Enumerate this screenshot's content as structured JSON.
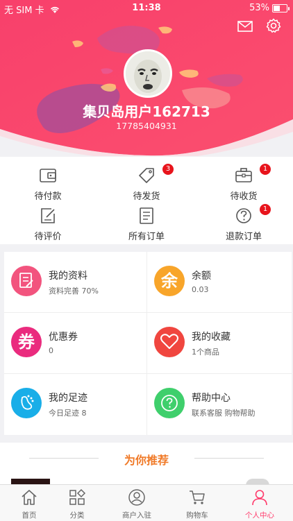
{
  "status_bar": {
    "carrier": "无 SIM 卡",
    "time": "11:38",
    "battery": "53%"
  },
  "profile": {
    "username": "集贝岛用户162713",
    "phone": "17785404931"
  },
  "orders": [
    {
      "label": "待付款",
      "icon": "wallet-icon",
      "badge": ""
    },
    {
      "label": "待发货",
      "icon": "tag-icon",
      "badge": "3"
    },
    {
      "label": "待收货",
      "icon": "briefcase-icon",
      "badge": "1"
    },
    {
      "label": "待评价",
      "icon": "edit-icon",
      "badge": ""
    },
    {
      "label": "所有订单",
      "icon": "document-icon",
      "badge": ""
    },
    {
      "label": "退款订单",
      "icon": "question-icon",
      "badge": "1"
    }
  ],
  "grid": [
    {
      "title": "我的资料",
      "sub": "资料完善 70%",
      "color": "#f2547e",
      "icon": "profile-icon"
    },
    {
      "title": "余额",
      "sub": "0.03",
      "color": "#f8a52a",
      "icon": "balance-icon",
      "glyph": "余"
    },
    {
      "title": "优惠券",
      "sub": "0",
      "color": "#ea2b7e",
      "icon": "coupon-icon",
      "glyph": "券"
    },
    {
      "title": "我的收藏",
      "sub": "1个商品",
      "color": "#f0463f",
      "icon": "heart-icon"
    },
    {
      "title": "我的足迹",
      "sub": "今日足迹 8",
      "color": "#19aee8",
      "icon": "footprint-icon"
    },
    {
      "title": "帮助中心",
      "sub": "联系客服 购物帮助",
      "color": "#3fcf6c",
      "icon": "help-icon"
    }
  ],
  "recommend": {
    "title": "为你推荐"
  },
  "tabbar": [
    {
      "label": "首页",
      "icon": "home-icon",
      "active": false
    },
    {
      "label": "分类",
      "icon": "category-icon",
      "active": false
    },
    {
      "label": "商户入驻",
      "icon": "merchant-icon",
      "active": false
    },
    {
      "label": "购物车",
      "icon": "cart-icon",
      "active": false
    },
    {
      "label": "个人中心",
      "icon": "user-icon",
      "active": true
    }
  ],
  "colors": {
    "accent": "#ff3a6b",
    "hero": "#f9456b",
    "recommend": "#f07a28",
    "badge": "#e8141c"
  }
}
